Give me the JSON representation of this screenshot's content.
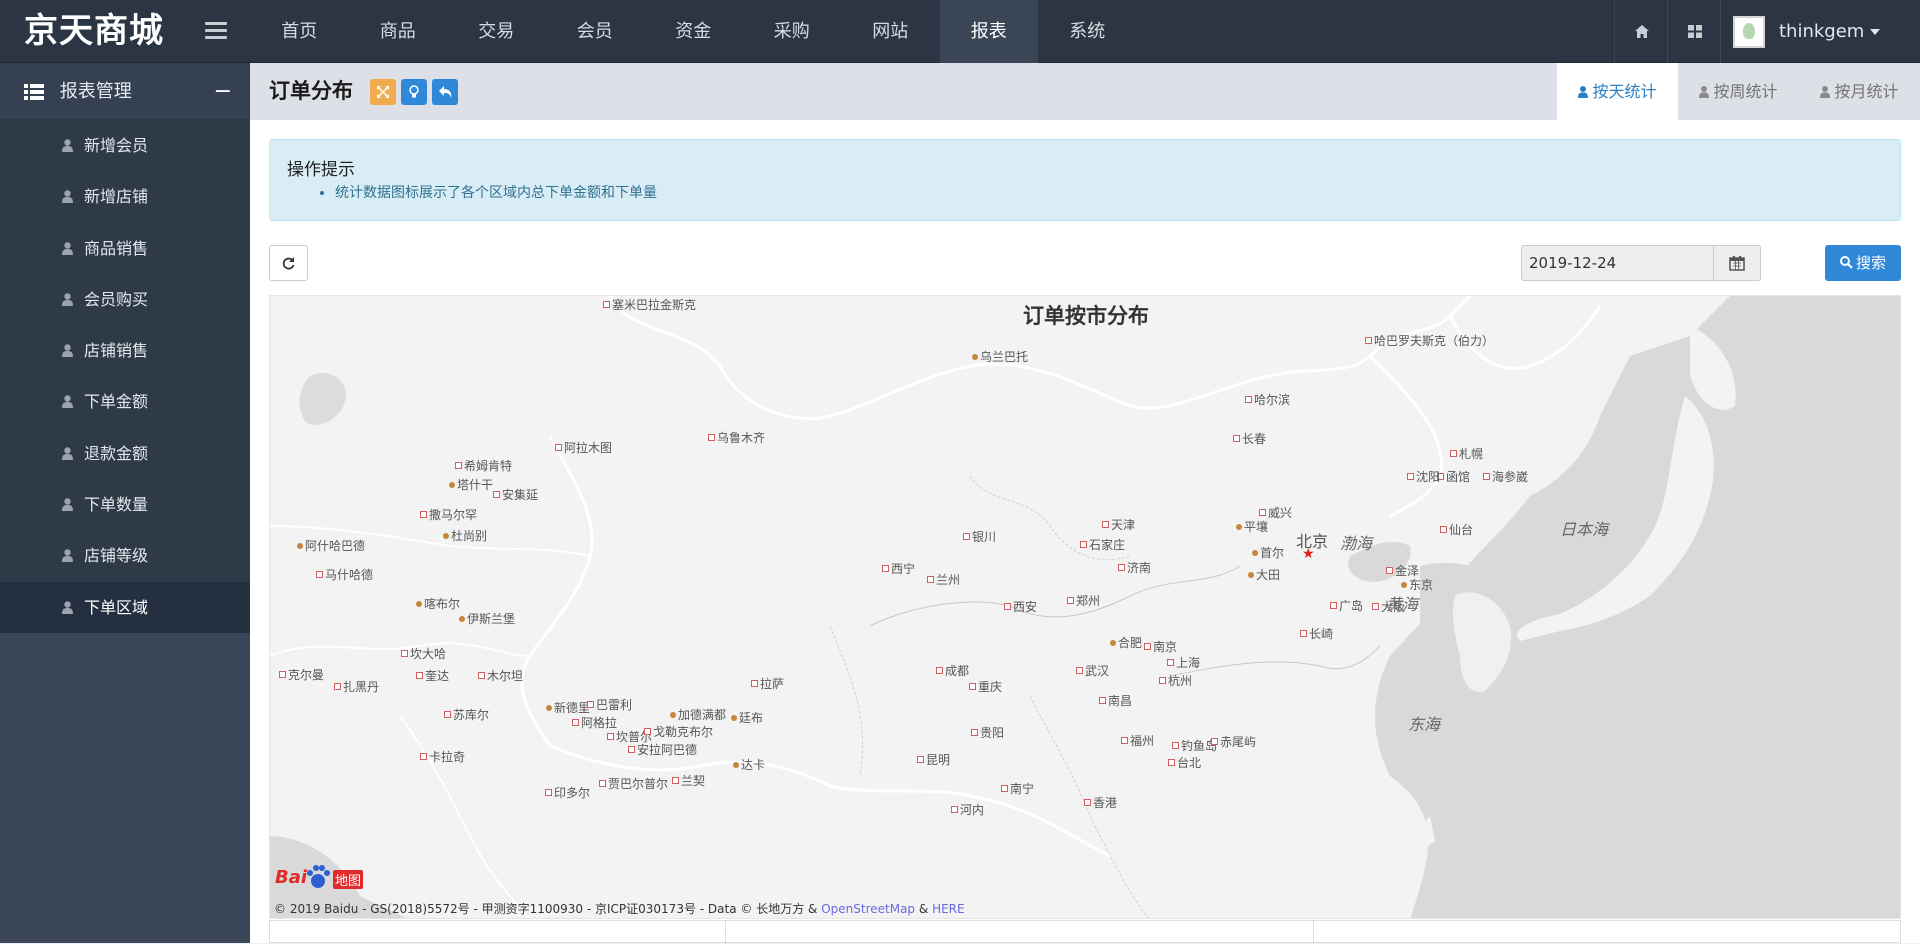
{
  "brand": "京天商城",
  "nav": [
    "首页",
    "商品",
    "交易",
    "会员",
    "资金",
    "采购",
    "网站",
    "报表",
    "系统"
  ],
  "nav_active": "报表",
  "user": {
    "name": "thinkgem"
  },
  "sidebar": {
    "title": "报表管理",
    "collapse": "−",
    "items": [
      "新增会员",
      "新增店铺",
      "商品销售",
      "会员购买",
      "店铺销售",
      "下单金额",
      "退款金额",
      "下单数量",
      "店铺等级",
      "下单区域"
    ],
    "active": "下单区域"
  },
  "page": {
    "title": "订单分布",
    "tabs": [
      "按天统计",
      "按周统计",
      "按月统计"
    ],
    "active_tab": "按天统计"
  },
  "alert": {
    "title": "操作提示",
    "items": [
      "统计数据图标展示了各个区域内总下单金额和下单量"
    ]
  },
  "filter": {
    "date": "2019-12-24",
    "search_label": "搜索"
  },
  "map": {
    "title": "订单按市分布",
    "capital": "北京",
    "copyright_text": "© 2019 Baidu - GS(2018)5572号 - 甲测资字1100930 - 京ICP证030173号 - Data © 长地万方 &",
    "copyright_link1": "OpenStreetMap",
    "copyright_amp": "&",
    "copyright_link2": "HERE",
    "logo_text": "Bai",
    "logo_text2": "地图",
    "cities": [
      "塞米巴拉金斯克",
      "乌兰巴托",
      "哈巴罗夫斯克（伯力）",
      "哈尔滨",
      "长春",
      "札幌",
      "函馆",
      "沈阳",
      "海参崴",
      "阿拉木图",
      "乌鲁木齐",
      "希姆肯特",
      "塔什干",
      "安集延",
      "撒马尔罕",
      "杜尚别",
      "阿什哈巴德",
      "马什哈德",
      "喀布尔",
      "伊斯兰堡",
      "坎大哈",
      "奎达",
      "木尔坦",
      "克尔曼",
      "扎黑丹",
      "苏库尔",
      "卡拉奇",
      "新德里",
      "巴雷利",
      "阿格拉",
      "坎普尔",
      "戈勒克布尔",
      "加德满都",
      "廷布",
      "安拉阿巴德",
      "达卡",
      "拉萨",
      "银川",
      "西宁",
      "兰州",
      "西安",
      "郑州",
      "石家庄",
      "天津",
      "济南",
      "平壤",
      "首尔",
      "大田",
      "威兴",
      "仙台",
      "东京",
      "金泽",
      "大阪",
      "广岛",
      "长崎",
      "合肥",
      "南京",
      "上海",
      "杭州",
      "武汉",
      "成都",
      "重庆",
      "南昌",
      "贵阳",
      "昆明",
      "福州",
      "钓鱼岛",
      "赤尾屿",
      "台北",
      "南宁",
      "香港",
      "河内",
      "贾巴尔普尔",
      "兰契",
      "印多尔"
    ],
    "seas": [
      "渤海",
      "黄海",
      "东海",
      "日本海"
    ]
  },
  "colors": {
    "topbar": "#2b3543",
    "sidebar": "#2f3a49",
    "primary": "#2f89d8",
    "alert_bg": "#d9edf7",
    "warning": "#f0ad4e"
  },
  "icons": [
    "hamburger-icon",
    "home-icon",
    "grid-icon",
    "list-icon",
    "user-icon",
    "expand-icon",
    "lightbulb-icon",
    "undo-icon",
    "refresh-icon",
    "calendar-icon",
    "search-icon"
  ]
}
